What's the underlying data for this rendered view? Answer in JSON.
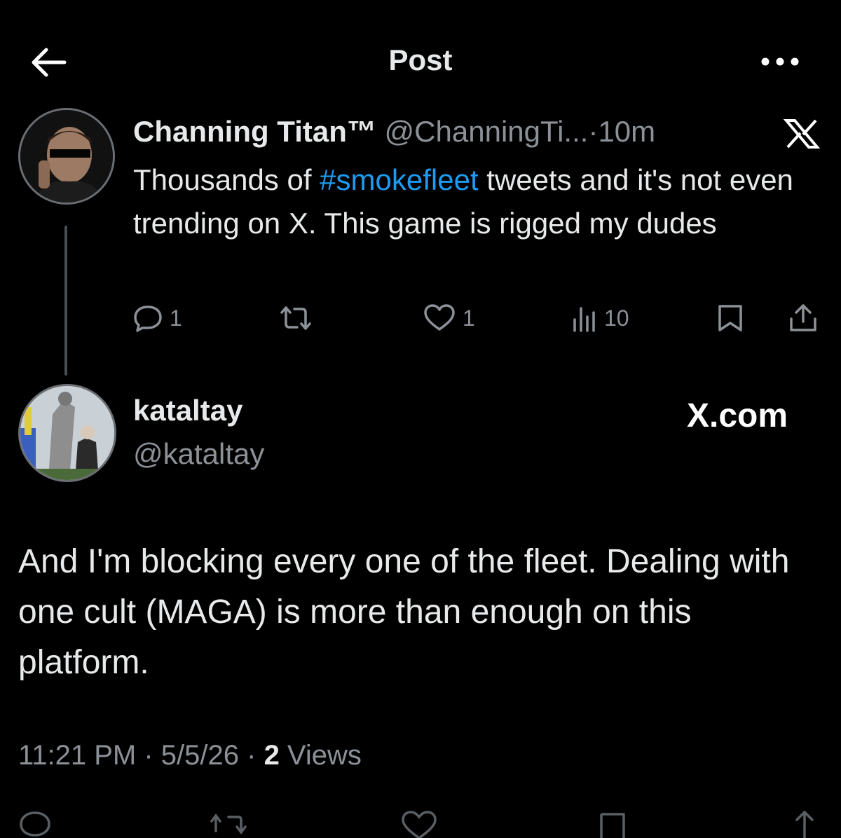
{
  "header": {
    "title": "Post",
    "back_icon": "arrow-left-icon",
    "more_icon": "more-horizontal-icon"
  },
  "post1": {
    "display_name": "Channing Titan™",
    "handle": "@ChanningTi...",
    "separator": "·",
    "time": "10m",
    "text_before": "Thousands of ",
    "hashtag": "#smokefleet",
    "text_after": " tweets and it's not even trending on X. This game is rigged my dudes",
    "actions": {
      "replies": "1",
      "likes": "1",
      "views": "10"
    }
  },
  "post2": {
    "display_name": "kataltay",
    "handle": "@kataltay",
    "watermark": "X.com",
    "text": "And I'm blocking every one of the fleet. Dealing with one cult (MAGA) is more than enough on this platform.",
    "time": "11:21 PM",
    "separator1": " · ",
    "date": "5/5/26",
    "separator2": " · ",
    "views_count": "2",
    "views_label": " Views"
  },
  "colors": {
    "background": "#000000",
    "text": "#e7e9ea",
    "muted": "#8b9197",
    "link": "#1d9bf0"
  }
}
